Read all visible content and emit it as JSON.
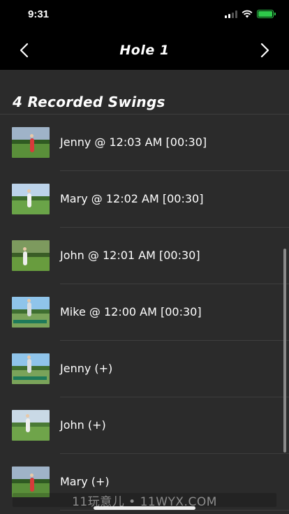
{
  "status_bar": {
    "time": "9:31",
    "icons": [
      "cellular-signal-icon",
      "wifi-icon",
      "battery-charging-icon"
    ],
    "battery_color": "#2ec84a"
  },
  "nav": {
    "title": "Hole 1",
    "back_icon": "chevron-left-icon",
    "forward_icon": "chevron-right-icon"
  },
  "section": {
    "header": "4 Recorded Swings"
  },
  "swings": [
    {
      "label": "Jenny @ 12:03 AM [00:30]",
      "thumb": "golfer-red-shirt"
    },
    {
      "label": "Mary @ 12:02 AM [00:30]",
      "thumb": "golfer-white"
    },
    {
      "label": "John @ 12:01 AM [00:30]",
      "thumb": "golfer-white-swing"
    },
    {
      "label": "Mike @ 12:00 AM [00:30]",
      "thumb": "golfer-driving-range"
    },
    {
      "label": "Jenny (+)",
      "thumb": "golfer-driving-range"
    },
    {
      "label": "John (+)",
      "thumb": "golfer-backswing"
    },
    {
      "label": "Mary (+)",
      "thumb": "golfer-red-shirt"
    }
  ],
  "watermark": "11玩意儿 • 11WYX.COM",
  "colors": {
    "background": "#000000",
    "list_background": "#2b2b2b",
    "separator": "#3e3e3e",
    "text": "#ffffff"
  }
}
